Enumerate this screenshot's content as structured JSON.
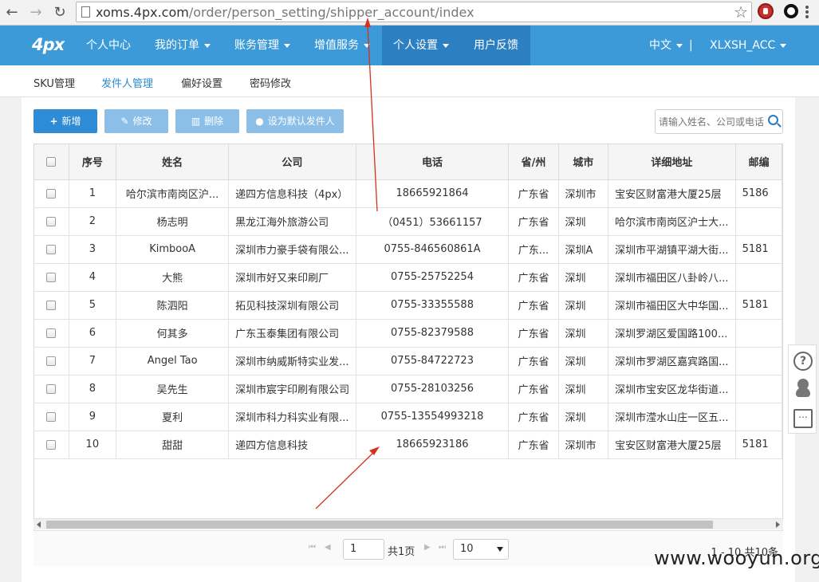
{
  "browser": {
    "back_glyph": "←",
    "forward_glyph": "→",
    "reload_glyph": "↻",
    "url_host": "xoms.4px.com",
    "url_path": "/order/person_setting/shipper_account/index",
    "star_glyph": "☆"
  },
  "navbar": {
    "logo": "4px",
    "items": [
      {
        "label": "个人中心",
        "dropdown": false
      },
      {
        "label": "我的订单",
        "dropdown": true
      },
      {
        "label": "账务管理",
        "dropdown": true
      },
      {
        "label": "增值服务",
        "dropdown": true
      },
      {
        "label": "个人设置",
        "dropdown": true,
        "active": true
      },
      {
        "label": "用户反馈",
        "dropdown": false
      }
    ],
    "language": "中文",
    "separator": "|",
    "account": "XLXSH_ACC"
  },
  "subnav": {
    "items": [
      {
        "label": "SKU管理"
      },
      {
        "label": "发件人管理",
        "active": true
      },
      {
        "label": "偏好设置"
      },
      {
        "label": "密码修改"
      }
    ]
  },
  "toolbar": {
    "add_label": "新增",
    "add_icon": "+",
    "edit_label": "修改",
    "edit_icon": "✎",
    "delete_label": "删除",
    "delete_icon": "▥",
    "default_label": "设为默认发件人",
    "default_icon": "●",
    "search_placeholder": "请输入姓名、公司或电话"
  },
  "table": {
    "columns": [
      "序号",
      "姓名",
      "公司",
      "电话",
      "省/州",
      "城市",
      "详细地址",
      "邮编"
    ],
    "rows": [
      {
        "no": "1",
        "name": "哈尔滨市南岗区沪...",
        "company": "递四方信息科技（4px）",
        "phone": "18665921864",
        "province": "广东省",
        "city": "深圳市",
        "address": "宝安区财富港大厦25层",
        "zip": "5186"
      },
      {
        "no": "2",
        "name": "杨志明",
        "company": "黑龙江海外旅游公司",
        "phone": "（0451）53661157",
        "province": "广东省",
        "city": "深圳",
        "address": "哈尔滨市南岗区沪士大...",
        "zip": ""
      },
      {
        "no": "3",
        "name": "KimbooA",
        "company": "深圳市力豪手袋有限公...",
        "phone": "0755-846560861A",
        "province": "广东...",
        "city": "深圳A",
        "address": "深圳市平湖镇平湖大街...",
        "zip": "5181"
      },
      {
        "no": "4",
        "name": "大熊",
        "company": "深圳市好又来印刷厂",
        "phone": "0755-25752254",
        "province": "广东省",
        "city": "深圳",
        "address": "深圳市福田区八卦岭八...",
        "zip": ""
      },
      {
        "no": "5",
        "name": "陈泗阳",
        "company": "拓见科技深圳有限公司",
        "phone": "0755-33355588",
        "province": "广东省",
        "city": "深圳",
        "address": "深圳市福田区大中华国...",
        "zip": "5181"
      },
      {
        "no": "6",
        "name": "何其多",
        "company": "广东玉泰集团有限公司",
        "phone": "0755-82379588",
        "province": "广东省",
        "city": "深圳",
        "address": "深圳罗湖区爱国路100...",
        "zip": ""
      },
      {
        "no": "7",
        "name": "Angel Tao",
        "company": "深圳市纳威斯特实业发...",
        "phone": "0755-84722723",
        "province": "广东省",
        "city": "深圳",
        "address": "深圳市罗湖区嘉宾路国...",
        "zip": ""
      },
      {
        "no": "8",
        "name": "吴先生",
        "company": "深圳市宸宇印刷有限公司",
        "phone": "0755-28103256",
        "province": "广东省",
        "city": "深圳",
        "address": "深圳市宝安区龙华街道...",
        "zip": ""
      },
      {
        "no": "9",
        "name": "夏利",
        "company": "深圳市科力科实业有限...",
        "phone": "0755-13554993218",
        "province": "广东省",
        "city": "深圳",
        "address": "深圳市滢水山庄一区五...",
        "zip": ""
      },
      {
        "no": "10",
        "name": "甜甜",
        "company": "递四方信息科技",
        "phone": "18665923186",
        "province": "广东省",
        "city": "深圳市",
        "address": "宝安区财富港大厦25层",
        "zip": "5181"
      }
    ]
  },
  "pager": {
    "first_glyph": "⏮",
    "prev_glyph": "◀",
    "next_glyph": "▶",
    "last_glyph": "⏭",
    "current_page": "1",
    "total_pages": "共1页",
    "page_size": "10",
    "summary": "1 - 10 共10条"
  },
  "float_bar": {
    "help_glyph": "?",
    "chat_glyph": "..."
  },
  "watermark": "www.wooyun.org",
  "colors": {
    "navbar": "#3c9ad9",
    "navbar_active": "#2c7fc0",
    "primary_button": "#2e8bd6",
    "disabled_button": "#8cbfe7",
    "annotation_arrow": "#d6301f"
  }
}
